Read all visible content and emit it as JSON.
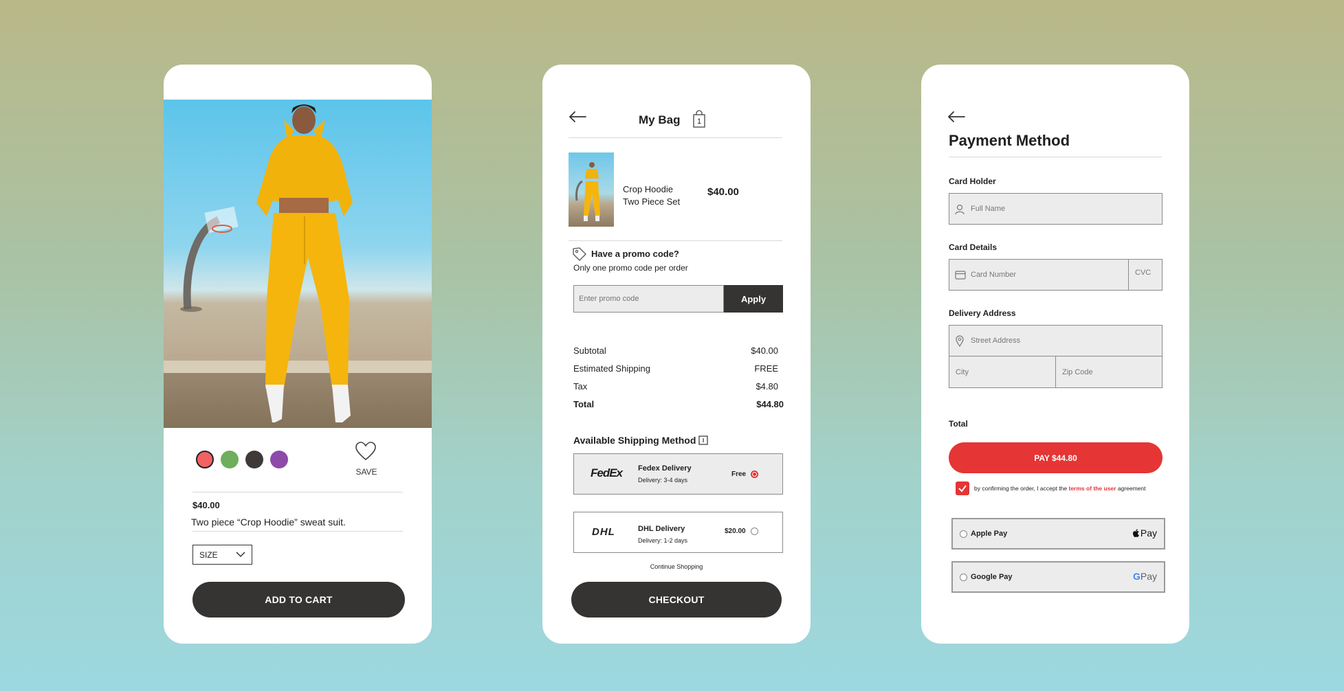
{
  "product_screen": {
    "save_label": "SAVE",
    "price": "$40.00",
    "description": "Two piece “Crop Hoodie” sweat suit.",
    "size_label": "SIZE",
    "add_to_cart_label": "ADD TO CART",
    "swatch_colors": [
      "#f26262",
      "#6fae5c",
      "#3f3937",
      "#8d4aa9"
    ]
  },
  "bag_screen": {
    "title": "My Bag",
    "bag_count": "1",
    "item": {
      "name_line1": "Crop Hoodie",
      "name_line2": "Two Piece Set",
      "price": "$40.00"
    },
    "promo": {
      "title": "Have a promo code?",
      "subtitle": "Only one promo code per order",
      "placeholder": "Enter promo code",
      "apply_label": "Apply"
    },
    "summary": [
      {
        "label": "Subtotal",
        "value": "$40.00"
      },
      {
        "label": "Estimated Shipping",
        "value": "FREE"
      },
      {
        "label": "Tax",
        "value": "$4.80"
      },
      {
        "label": "Total",
        "value": "$44.80"
      }
    ],
    "shipping_title": "Available Shipping Method",
    "shipping_options": [
      {
        "logo": "FedEx",
        "name": "Fedex Delivery",
        "eta": "Delivery: 3-4 days",
        "price": "Free",
        "selected": true
      },
      {
        "logo": "DHL",
        "name": "DHL Delivery",
        "eta": "Delivery: 1-2 days",
        "price": "$20.00",
        "selected": false
      }
    ],
    "continue_label": "Continue Shopping",
    "checkout_label": "CHECKOUT"
  },
  "payment_screen": {
    "title": "Payment Method",
    "card_holder_label": "Card Holder",
    "full_name_placeholder": "Full Name",
    "card_details_label": "Card Details",
    "card_number_placeholder": "Card Number",
    "cvc_placeholder": "CVC",
    "delivery_label": "Delivery Address",
    "street_placeholder": "Street Address",
    "city_placeholder": "City",
    "zip_placeholder": "Zip Code",
    "total_label": "Total",
    "pay_label": "PAY $44.80",
    "terms_prefix": "by confirming the order, I accept the ",
    "terms_link": "terms of the user",
    "terms_suffix": " agreement",
    "apple_pay_label": "Apple Pay",
    "apple_pay_logo": "Pay",
    "google_pay_label": "Google Pay",
    "google_pay_logo_g": "G",
    "google_pay_logo_pay": "Pay",
    "accent_color": "#e53535"
  }
}
